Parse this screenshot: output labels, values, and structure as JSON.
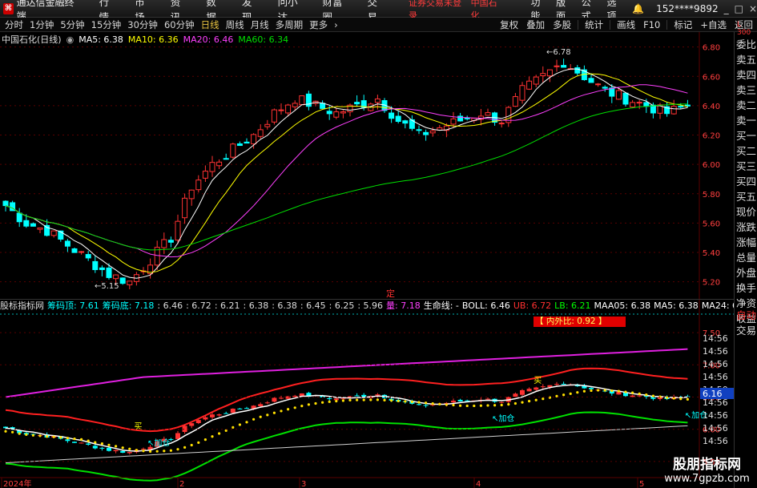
{
  "app": {
    "title": "通达信金融终端",
    "logo": "logo-icon"
  },
  "menu": [
    "行情",
    "市场",
    "资讯",
    "数据",
    "发现",
    "问小达",
    "财富圈",
    "交易"
  ],
  "notice": {
    "text": "证券交易未登录",
    "stock": "中国石化",
    "color": "#ff3b3b"
  },
  "right_menu": [
    "功能",
    "版面",
    "公式",
    "选项"
  ],
  "user": "152****9892",
  "window_buttons": [
    "_",
    "□",
    "×"
  ],
  "periods": [
    "分时",
    "1分钟",
    "5分钟",
    "15分钟",
    "30分钟",
    "60分钟",
    "日线",
    "周线",
    "月线",
    "多周期",
    "更多"
  ],
  "active_period": "日线",
  "tools": [
    "复权",
    "叠加",
    "多股",
    "统计",
    "画线",
    "F10",
    "标记",
    "+自选",
    "返回"
  ],
  "main_legend": {
    "name": "中国石化(日线)",
    "ma5": "MA5: 6.38",
    "ma10": "MA10: 6.36",
    "ma20": "MA20: 6.46",
    "ma60": "MA60: 6.34",
    "colors": {
      "ma5": "#ffffff",
      "ma10": "#ffff00",
      "ma20": "#ff40ff",
      "ma60": "#00e000"
    }
  },
  "side_panel": [
    "委比",
    "卖五",
    "卖四",
    "卖三",
    "卖二",
    "卖一",
    "买一",
    "买二",
    "买三",
    "买四",
    "买五",
    "现价",
    "涨跌",
    "涨幅",
    "总量",
    "外盘",
    "换手",
    "净资",
    "收益"
  ],
  "side_buttons": [
    "自动",
    "交易"
  ],
  "price_axis": [
    "6.80",
    "6.60",
    "6.40",
    "6.20",
    "6.00",
    "5.80",
    "5.60",
    "5.40",
    "5.20"
  ],
  "price_axis_badge": "L 300",
  "annotations": {
    "high": "6.78",
    "low": "5.15",
    "marker": "定"
  },
  "indicator_bar": [
    {
      "text": "股标指标网",
      "color": "#dddddd"
    },
    {
      "text": "筹码顶: 7.61",
      "color": "#00ffff"
    },
    {
      "text": "筹码底: 7.18",
      "color": "#00ffff"
    },
    {
      "text": ": 6.46",
      "color": "#dddddd"
    },
    {
      "text": ": 6.72",
      "color": "#dddddd"
    },
    {
      "text": ": 6.21",
      "color": "#dddddd"
    },
    {
      "text": ": 6.38",
      "color": "#dddddd"
    },
    {
      "text": ": 6.38",
      "color": "#dddddd"
    },
    {
      "text": ": 6.45",
      "color": "#dddddd"
    },
    {
      "text": ": 6.25",
      "color": "#dddddd"
    },
    {
      "text": ": 5.96",
      "color": "#dddddd"
    },
    {
      "text": "量: 7.18",
      "color": "#ff40ff"
    },
    {
      "text": "生命线: -",
      "color": "#ffffff"
    },
    {
      "text": "BOLL: 6.46",
      "color": "#ffffff"
    },
    {
      "text": "UB: 6.72",
      "color": "#ff3030"
    },
    {
      "text": "LB: 6.21",
      "color": "#00ff00"
    },
    {
      "text": "MAA05: 6.38",
      "color": "#ffffff"
    },
    {
      "text": "MA5: 6.38",
      "color": "#ffffff"
    },
    {
      "text": "MA24: 6.45",
      "color": "#ffffff"
    },
    {
      "text": "MA72: 6.25",
      "color": "#ffffff"
    },
    {
      "text": "MA200:",
      "color": "#ffffff"
    }
  ],
  "ratio_box": "【 内外比: 0.92 】",
  "lower_axis": [
    "7.50",
    "7.00",
    "6.50",
    "6.00",
    "5.50"
  ],
  "lower_right_tags": [
    "14:56",
    "14:56",
    "14:56",
    "14:56",
    "14:50",
    "14:56",
    "14:56",
    "14:56",
    "14:56"
  ],
  "price_tag": "6.16",
  "signals": {
    "add": "加仓",
    "buy": "买"
  },
  "time_axis": [
    "2024年",
    "2",
    "3",
    "4",
    "5"
  ],
  "watermark": {
    "line1": "股朋指标网",
    "line2": "www.7gpzb.com"
  }
}
